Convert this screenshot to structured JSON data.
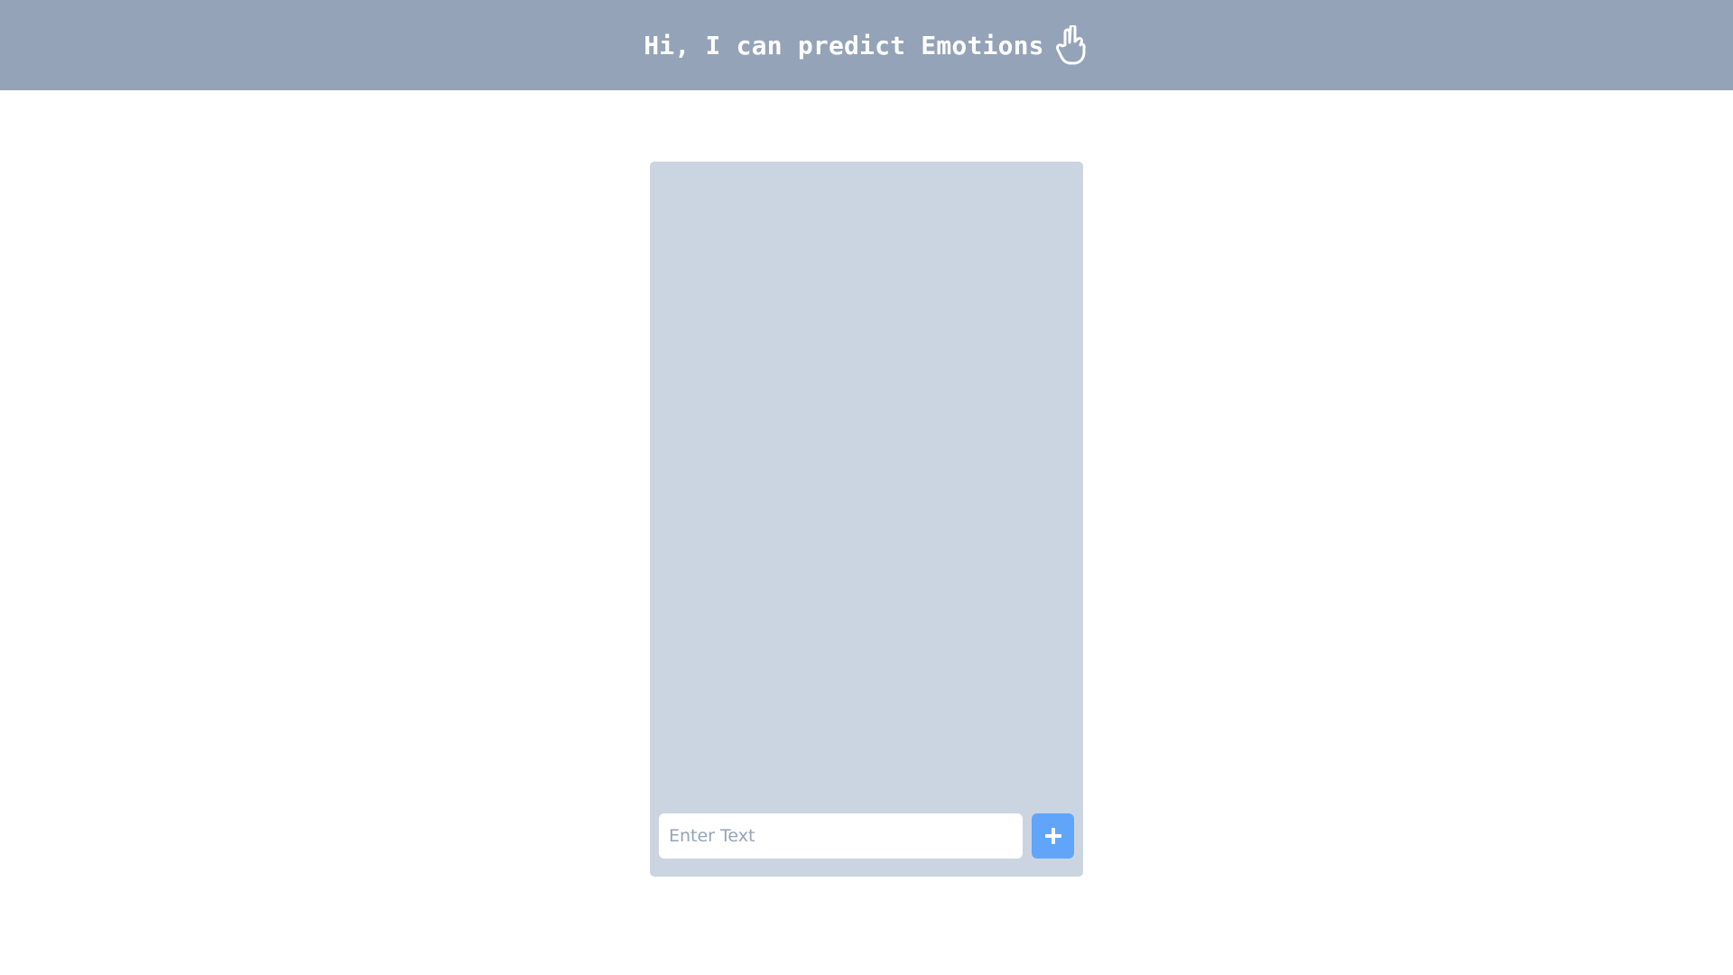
{
  "header": {
    "title": "Hi, I can predict Emotions",
    "icon": "hand-pointing-icon",
    "background": "#94a3b8",
    "text_color": "#ffffff"
  },
  "chat_panel": {
    "background": "#cbd5e1",
    "input": {
      "value": "",
      "placeholder": "Enter Text"
    },
    "add_button": {
      "icon": "plus-icon",
      "color": "#60a5fa"
    }
  }
}
